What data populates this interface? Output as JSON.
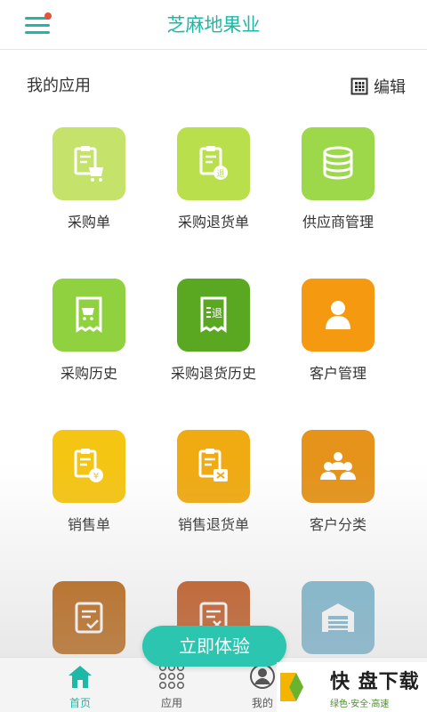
{
  "header": {
    "title": "芝麻地果业"
  },
  "section": {
    "title": "我的应用",
    "edit_label": "编辑"
  },
  "apps": [
    {
      "label": "采购单",
      "icon": "purchase-order-icon",
      "color": "#c5e26a"
    },
    {
      "label": "采购退货单",
      "icon": "purchase-return-icon",
      "color": "#b9e04c"
    },
    {
      "label": "供应商管理",
      "icon": "supplier-database-icon",
      "color": "#9cd84a"
    },
    {
      "label": "采购历史",
      "icon": "purchase-history-icon",
      "color": "#8fd13e"
    },
    {
      "label": "采购退货历史",
      "icon": "purchase-return-history-icon",
      "color": "#5aa721"
    },
    {
      "label": "客户管理",
      "icon": "customer-icon",
      "color": "#f59a10"
    },
    {
      "label": "销售单",
      "icon": "sales-order-icon",
      "color": "#f5c513"
    },
    {
      "label": "销售退货单",
      "icon": "sales-return-icon",
      "color": "#f0aa12"
    },
    {
      "label": "客户分类",
      "icon": "customer-group-icon",
      "color": "#e5931a"
    },
    {
      "label": "",
      "icon": "document-check-icon",
      "color": "#b8630f"
    },
    {
      "label": "",
      "icon": "document-cancel-icon",
      "color": "#c0541a"
    },
    {
      "label": "",
      "icon": "warehouse-icon",
      "color": "#7ab6cf"
    }
  ],
  "cta": {
    "label": "立即体验"
  },
  "tabs": [
    {
      "label": "首页",
      "icon": "home-icon",
      "active": true
    },
    {
      "label": "应用",
      "icon": "apps-grid-icon",
      "active": false
    },
    {
      "label": "我的",
      "icon": "user-icon",
      "active": false
    }
  ],
  "watermark": {
    "main": "快 盘下载",
    "sub": "绿色·安全·高速"
  }
}
